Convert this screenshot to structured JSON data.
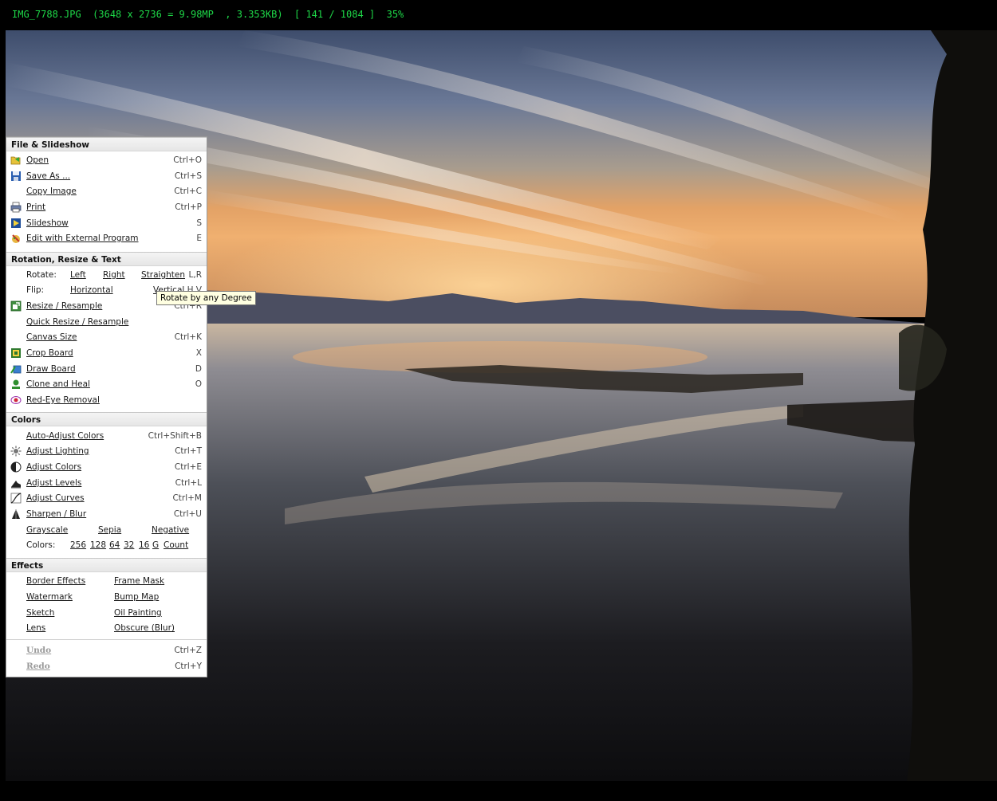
{
  "status": {
    "text": "IMG_7788.JPG  (3648 x 2736 = 9.98MP  , 3.353KB)  [ 141 / 1084 ]  35%"
  },
  "menu": {
    "file_section": {
      "header": "File & Slideshow",
      "items": [
        {
          "label": "Open",
          "shortcut": "Ctrl+O",
          "icon": "open-folder-icon"
        },
        {
          "label": "Save As ...",
          "shortcut": "Ctrl+S",
          "icon": "floppy-disk-icon"
        },
        {
          "label": "Copy Image",
          "shortcut": "Ctrl+C",
          "icon": ""
        },
        {
          "label": "Print",
          "shortcut": "Ctrl+P",
          "icon": "printer-icon"
        },
        {
          "label": "Slideshow",
          "shortcut": "S",
          "icon": "slideshow-icon"
        },
        {
          "label": "Edit with External Program",
          "shortcut": "E",
          "icon": "external-edit-icon"
        }
      ]
    },
    "rotation_section": {
      "header": "Rotation, Resize & Text",
      "rotate": {
        "label": "Rotate:",
        "left": "Left",
        "right": "Right",
        "straighten": "Straighten",
        "shortcut": "L,R"
      },
      "flip": {
        "label": "Flip:",
        "horizontal": "Horizontal",
        "vertical": "Vertical",
        "shortcut": "H,V"
      },
      "items": [
        {
          "label": "Resize / Resample",
          "shortcut": "Ctrl+R",
          "icon": "resize-icon"
        },
        {
          "label": "Quick Resize / Resample",
          "shortcut": "",
          "icon": ""
        },
        {
          "label": "Canvas Size",
          "shortcut": "Ctrl+K",
          "icon": ""
        },
        {
          "label": "Crop Board",
          "shortcut": "X",
          "icon": "crop-board-icon"
        },
        {
          "label": "Draw Board",
          "shortcut": "D",
          "icon": "draw-board-icon"
        },
        {
          "label": "Clone and Heal",
          "shortcut": "O",
          "icon": "clone-heal-icon"
        },
        {
          "label": "Red-Eye Removal",
          "shortcut": "",
          "icon": "red-eye-icon"
        }
      ]
    },
    "colors_section": {
      "header": "Colors",
      "items": [
        {
          "label": "Auto-Adjust Colors",
          "shortcut": "Ctrl+Shift+B",
          "icon": ""
        },
        {
          "label": "Adjust Lighting",
          "shortcut": "Ctrl+T",
          "icon": "lighting-icon"
        },
        {
          "label": "Adjust Colors",
          "shortcut": "Ctrl+E",
          "icon": "color-wheel-icon"
        },
        {
          "label": "Adjust Levels",
          "shortcut": "Ctrl+L",
          "icon": "levels-icon"
        },
        {
          "label": "Adjust Curves",
          "shortcut": "Ctrl+M",
          "icon": "curves-icon"
        },
        {
          "label": "Sharpen / Blur",
          "shortcut": "Ctrl+U",
          "icon": "sharpen-icon"
        }
      ],
      "modes": {
        "grayscale": "Grayscale",
        "sepia": "Sepia",
        "negative": "Negative"
      },
      "depth": {
        "label": "Colors:",
        "options": [
          "256",
          "128",
          "64",
          "32",
          "16",
          "G",
          "Count"
        ]
      }
    },
    "effects_section": {
      "header": "Effects",
      "left": [
        "Border Effects",
        "Watermark",
        "Sketch",
        "Lens"
      ],
      "right": [
        "Frame Mask",
        "Bump Map",
        "Oil Painting",
        "Obscure (Blur)"
      ]
    },
    "history": [
      {
        "label": "Undo",
        "shortcut": "Ctrl+Z"
      },
      {
        "label": "Redo",
        "shortcut": "Ctrl+Y"
      }
    ]
  },
  "tooltip": {
    "text": "Rotate by any Degree"
  },
  "colors": {
    "status_text": "#1ed848",
    "tooltip_bg": "#ffffe1"
  }
}
